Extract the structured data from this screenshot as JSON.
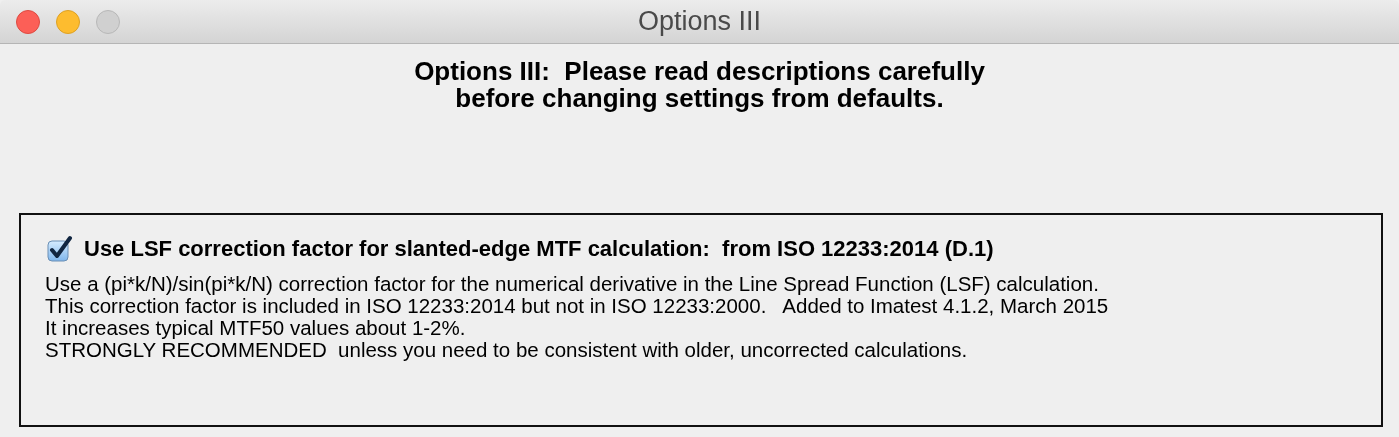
{
  "window": {
    "title": "Options III",
    "controls": [
      {
        "kind": "close",
        "disabled": false
      },
      {
        "kind": "minimize",
        "disabled": false
      },
      {
        "kind": "zoom",
        "disabled": true
      }
    ]
  },
  "heading": [
    "Options III:  Please read descriptions carefully",
    "before changing settings from defaults."
  ],
  "option": {
    "label": "Use LSF correction factor for slanted-edge MTF calculation:  from ISO 12233:2014 (D.1)",
    "checked": true,
    "description": [
      "Use a (pi*k/N)/sin(pi*k/N) correction factor for the numerical derivative in the Line Spread Function (LSF) calculation.",
      "This correction factor is included in ISO 12233:2014 but not in ISO 12233:2000.   Added to Imatest 4.1.2, March 2015",
      "It increases typical MTF50 values about 1-2%.",
      "STRONGLY RECOMMENDED  unless you need to be consistent with older, uncorrected calculations."
    ]
  }
}
